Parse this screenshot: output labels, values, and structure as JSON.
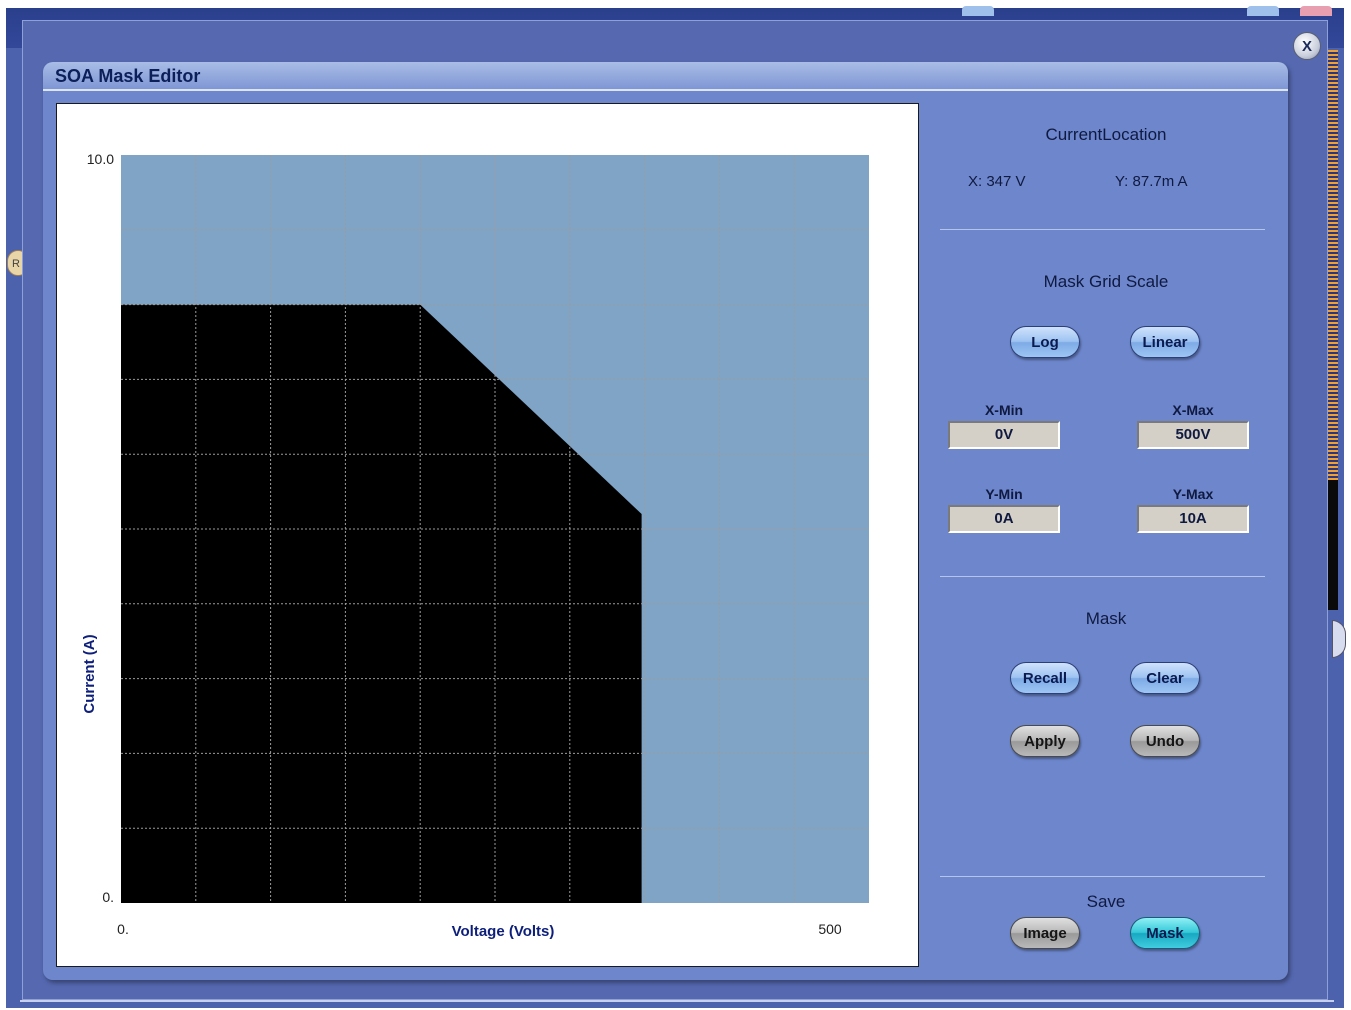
{
  "dialog": {
    "title": "SOA Mask Editor",
    "close_label": "X"
  },
  "background": {
    "side_badge_label": "R"
  },
  "chart": {
    "ylabel": "Current (A)",
    "xlabel": "Voltage (Volts)",
    "y_max_label": "10.0",
    "y_min_label": "0.",
    "x_min_label": "0.",
    "x_max_label": "500"
  },
  "chart_data": {
    "type": "area",
    "title": "",
    "xlabel": "Voltage (Volts)",
    "ylabel": "Current (A)",
    "xlim": [
      0,
      500
    ],
    "ylim": [
      0,
      10
    ],
    "grid": true,
    "x_divisions": 10,
    "y_divisions": 10,
    "mask_polygon": [
      {
        "x": 0,
        "y": 0
      },
      {
        "x": 0,
        "y": 8
      },
      {
        "x": 200,
        "y": 8
      },
      {
        "x": 348,
        "y": 5.2
      },
      {
        "x": 348,
        "y": 0
      }
    ],
    "plot_background_color": "#7fa4c6",
    "mask_color": "#000000"
  },
  "current_location": {
    "heading": "CurrentLocation",
    "x_text": "X: 347 V",
    "y_text": "Y: 87.7m A"
  },
  "mask_grid_scale": {
    "heading": "Mask Grid Scale",
    "log_label": "Log",
    "linear_label": "Linear",
    "x_min_label": "X-Min",
    "x_min_value": "0V",
    "x_max_label": "X-Max",
    "x_max_value": "500V",
    "y_min_label": "Y-Min",
    "y_min_value": "0A",
    "y_max_label": "Y-Max",
    "y_max_value": "10A"
  },
  "mask": {
    "heading": "Mask",
    "recall_label": "Recall",
    "clear_label": "Clear",
    "apply_label": "Apply",
    "undo_label": "Undo"
  },
  "save": {
    "heading": "Save",
    "image_label": "Image",
    "mask_label": "Mask"
  }
}
